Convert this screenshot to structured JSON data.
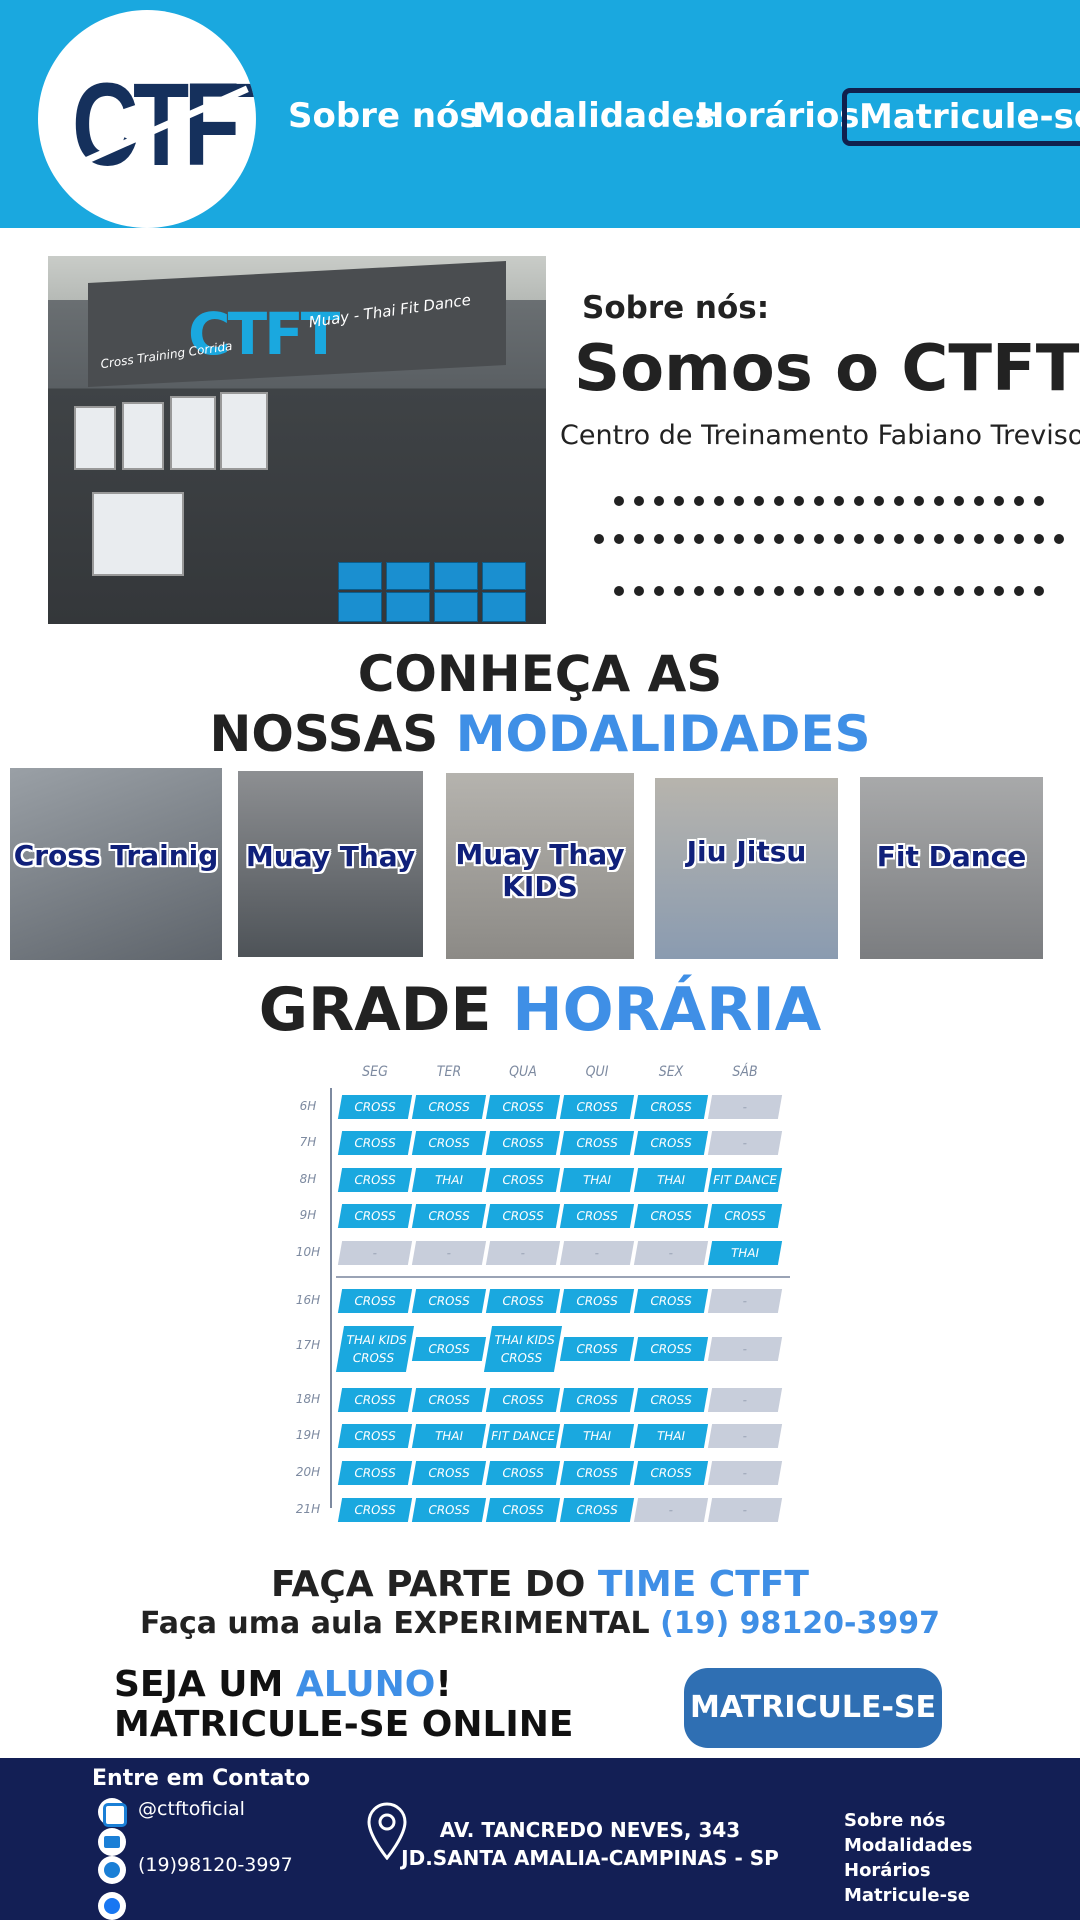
{
  "header": {
    "logo_text": "CTFT",
    "nav": [
      "Sobre nós",
      "Modalidades",
      "Horários",
      "Matricule-se"
    ]
  },
  "about": {
    "photo_sign_logo": "CTFT",
    "photo_sign_left": "Cross Training Corrida",
    "photo_sign_right": "Muay - Thai Fit Dance",
    "kicker": "Sobre nós:",
    "title": "Somos o CTFT",
    "subtitle": "Centro de Treinamento Fabiano Treviso"
  },
  "modalities": {
    "heading_line1": "CONHEÇA AS",
    "heading_line2_prefix": "NOSSAS ",
    "heading_line2_accent": "MODALIDADES",
    "cards": [
      {
        "label": "Cross Trainig"
      },
      {
        "label": "Muay Thay"
      },
      {
        "label": "Muay Thay KIDS"
      },
      {
        "label": "Jiu Jitsu"
      },
      {
        "label": "Fit Dance"
      }
    ]
  },
  "schedule": {
    "heading_prefix": "GRADE ",
    "heading_accent": "HORÁRIA",
    "days": [
      "SEG",
      "TER",
      "QUA",
      "QUI",
      "SEX",
      "SÁB"
    ],
    "rows": [
      {
        "hour": "6H",
        "cells": [
          "CROSS",
          "CROSS",
          "CROSS",
          "CROSS",
          "CROSS",
          "-"
        ]
      },
      {
        "hour": "7H",
        "cells": [
          "CROSS",
          "CROSS",
          "CROSS",
          "CROSS",
          "CROSS",
          "-"
        ]
      },
      {
        "hour": "8H",
        "cells": [
          "CROSS",
          "THAI",
          "CROSS",
          "THAI",
          "THAI",
          "FIT DANCE"
        ]
      },
      {
        "hour": "9H",
        "cells": [
          "CROSS",
          "CROSS",
          "CROSS",
          "CROSS",
          "CROSS",
          "CROSS"
        ]
      },
      {
        "hour": "10H",
        "cells": [
          "-",
          "-",
          "-",
          "-",
          "-",
          "THAI"
        ]
      },
      {
        "hour": "16H",
        "cells": [
          "CROSS",
          "CROSS",
          "CROSS",
          "CROSS",
          "CROSS",
          "-"
        ]
      },
      {
        "hour": "17H",
        "cells": [
          "THAI KIDS / CROSS",
          "CROSS",
          "THAI KIDS / CROSS",
          "CROSS",
          "CROSS",
          "-"
        ]
      },
      {
        "hour": "18H",
        "cells": [
          "CROSS",
          "CROSS",
          "CROSS",
          "CROSS",
          "CROSS",
          "-"
        ]
      },
      {
        "hour": "19H",
        "cells": [
          "CROSS",
          "THAI",
          "FIT DANCE",
          "THAI",
          "THAI",
          "-"
        ]
      },
      {
        "hour": "20H",
        "cells": [
          "CROSS",
          "CROSS",
          "CROSS",
          "CROSS",
          "CROSS",
          "-"
        ]
      },
      {
        "hour": "21H",
        "cells": [
          "CROSS",
          "CROSS",
          "CROSS",
          "CROSS",
          "-",
          "-"
        ]
      }
    ]
  },
  "join": {
    "line1_prefix": "FAÇA PARTE DO ",
    "line1_accent": "TIME CTFT",
    "line2_prefix": "Faça uma aula EXPERIMENTAL ",
    "line2_accent": "(19) 98120-3997",
    "seja_prefix": "SEJA UM ",
    "seja_accent": "ALUNO",
    "seja_suffix": "!",
    "online": "MATRICULE-SE ONLINE",
    "button": "MATRICULE-SE"
  },
  "footer": {
    "title": "Entre em Contato",
    "instagram": "@ctftoficial",
    "phone": "(19)98120-3997",
    "address_line1": "AV. TANCREDO NEVES, 343",
    "address_line2": "JD.SANTA AMALIA-CAMPINAS - SP",
    "links": [
      "Sobre nós",
      "Modalidades",
      "Horários",
      "Matricule-se"
    ]
  },
  "colors": {
    "header_bg": "#1aa8df",
    "accent": "#3f8fe6",
    "footer_bg": "#131f55",
    "button": "#2f6fb3",
    "nav_border": "#10204d"
  }
}
